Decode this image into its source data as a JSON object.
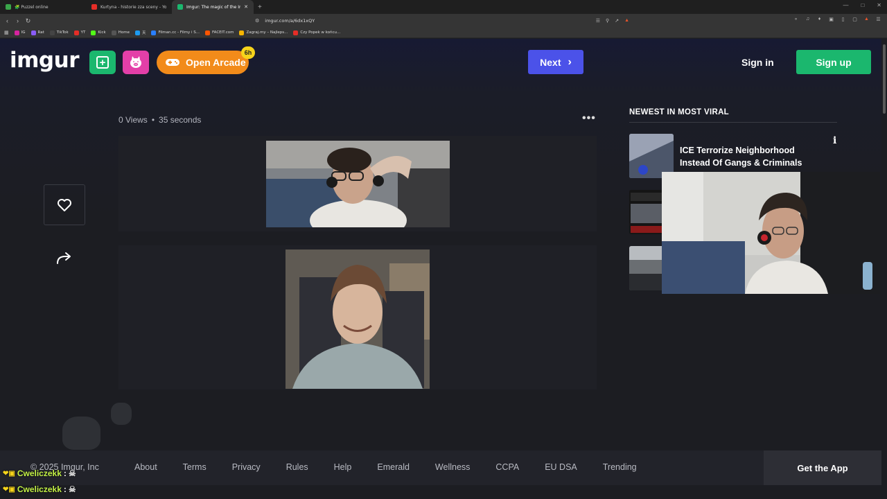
{
  "browser": {
    "tabs": [
      {
        "label": "🧩 Puzzel online",
        "color": "#3aa64a",
        "active": false
      },
      {
        "label": "Kurtyna - historie zza sceny - YouTube",
        "color": "#e52d27",
        "active": false
      },
      {
        "label": "Imgur: The magic of the Internet",
        "color": "#1bb76e",
        "active": true,
        "close": "✕"
      }
    ],
    "new_tab": "+",
    "url": "imgur.com/a/6dx1xQY",
    "bookmarks": [
      {
        "label": "IG",
        "color": "#d6249f"
      },
      {
        "label": "Rat",
        "color": "#8a5cf6"
      },
      {
        "label": "TikTok",
        "color": "#222222"
      },
      {
        "label": "YT",
        "color": "#e52d27"
      },
      {
        "label": "Kick",
        "color": "#53fc18"
      },
      {
        "label": "Home",
        "color": "#000000"
      },
      {
        "label": "天",
        "color": "#1d9bf0"
      },
      {
        "label": "Filman.cc - Filmy i S...",
        "color": "#2a7fff"
      },
      {
        "label": "FACEIT.com",
        "color": "#ff5500"
      },
      {
        "label": "Zagraj.my – Najleps...",
        "color": "#f5b400"
      },
      {
        "label": "Czy Popek w końcu...",
        "color": "#e52d27"
      }
    ]
  },
  "header": {
    "logo": "imgur",
    "arcade_label": "Open Arcade",
    "arcade_badge": "6h",
    "next_label": "Next",
    "signin_label": "Sign in",
    "signup_label": "Sign up"
  },
  "post": {
    "views": "0 Views",
    "separator": "•",
    "age": "35 seconds",
    "more": "•••"
  },
  "sidebar": {
    "heading": "NEWEST IN MOST VIRAL",
    "items": [
      {
        "title": "ICE Terrorize Neighborhood Instead Of Gangs & Criminals",
        "info": "i"
      }
    ]
  },
  "footer": {
    "copyright": "© 2025 Imgur, Inc",
    "links": [
      "About",
      "Terms",
      "Privacy",
      "Rules",
      "Help",
      "Emerald",
      "Wellness",
      "CCPA",
      "EU DSA",
      "Trending"
    ],
    "get_app": "Get the App"
  },
  "chat": [
    {
      "user": "Cweliczekk",
      "colon": ":"
    },
    {
      "user": "Cweliczekk",
      "colon": ":"
    }
  ],
  "colors": {
    "imgur_green": "#1bb76e",
    "next_blue": "#4b52e9",
    "arcade_orange": "#f28b1a",
    "pig_pink": "#e33fa8",
    "chat_name": "#c4f246"
  }
}
